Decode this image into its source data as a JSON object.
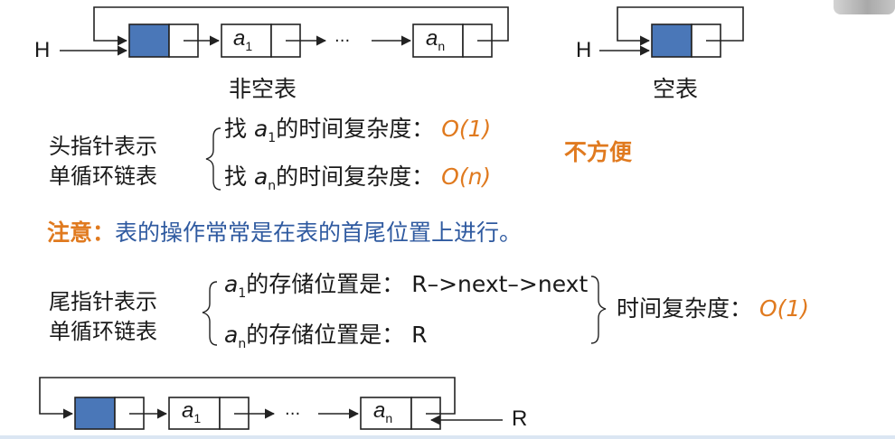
{
  "top_nonempty": {
    "head_label": "H",
    "first_node": "a",
    "first_sub": "1",
    "ellipsis": "···",
    "last_node": "a",
    "last_sub": "n",
    "caption": "非空表"
  },
  "top_empty": {
    "head_label": "H",
    "caption": "空表"
  },
  "head_pointer": {
    "label_line1": "头指针表示",
    "label_line2": "单循环链表",
    "find_word": "找",
    "var": "a",
    "sub_first": "1",
    "sub_last": "n",
    "rest": "的时间复杂度：",
    "complexity_first": "O(1)",
    "complexity_last": "O(n)",
    "verdict": "不方便"
  },
  "note": {
    "label": "注意：",
    "text": "表的操作常常是在表的首尾位置上进行。"
  },
  "tail_pointer": {
    "label_line1": "尾指针表示",
    "label_line2": "单循环链表",
    "var": "a",
    "sub_first": "1",
    "sub_last": "n",
    "storage_rest": "的存储位置是：",
    "value_first": "R–>next–>next",
    "value_last": "R",
    "summary_text": "时间复杂度：",
    "summary_value": "O(1)"
  },
  "bottom_list": {
    "first_node": "a",
    "first_sub": "1",
    "ellipsis": "···",
    "last_node": "a",
    "last_sub": "n",
    "tail_label": "R"
  },
  "colors": {
    "head_node_fill": "#4a77b8",
    "accent": "#e07a1f",
    "note_blue": "#2f5aa0"
  }
}
